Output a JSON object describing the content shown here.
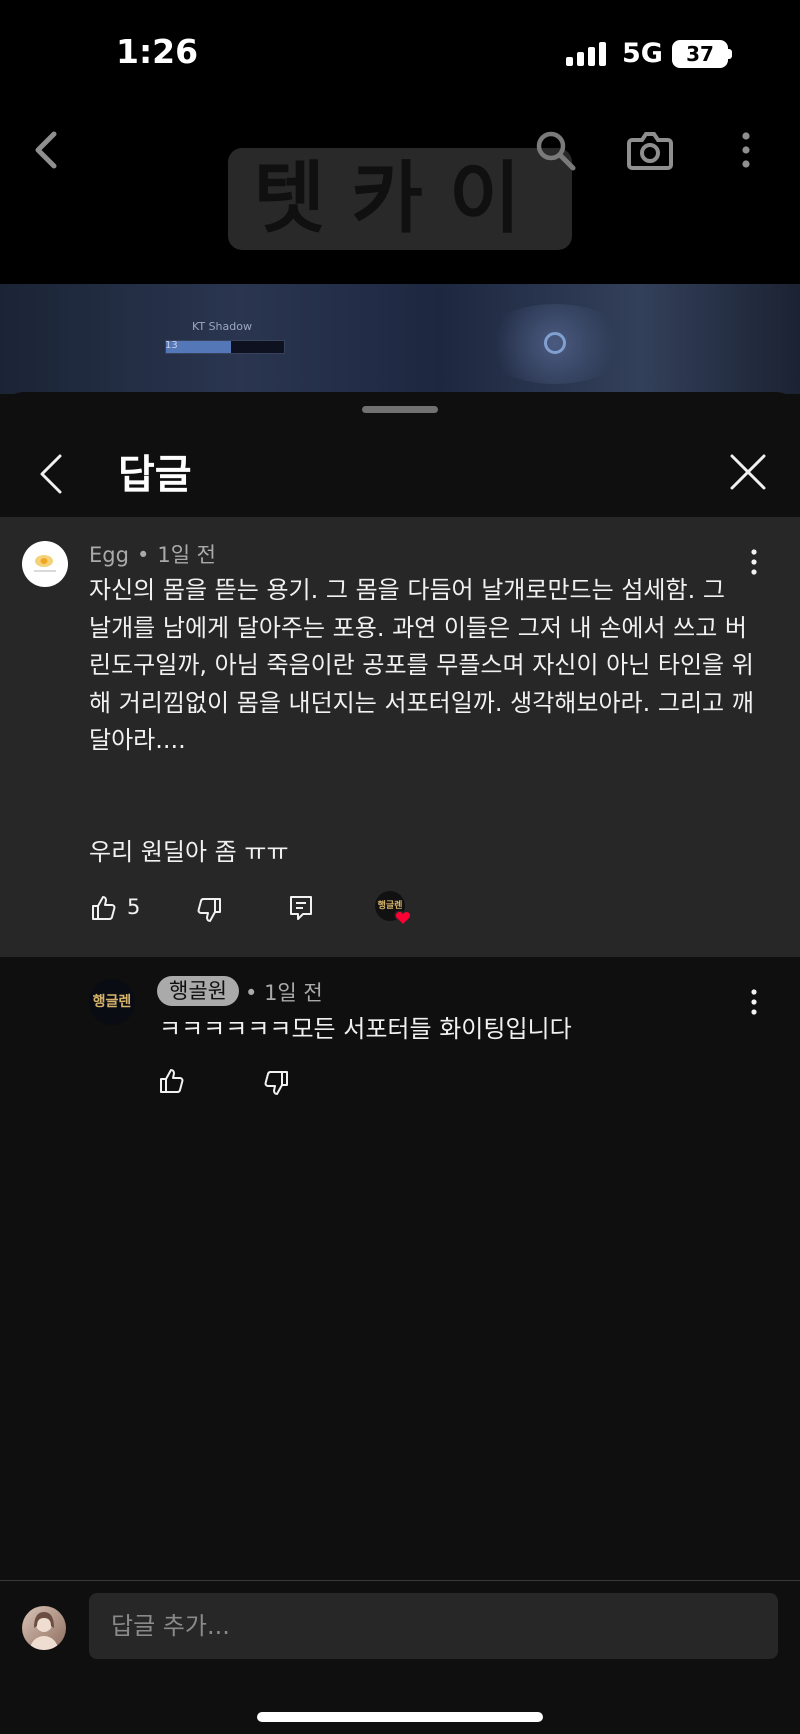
{
  "status_bar": {
    "time": "1:26",
    "network": "5G",
    "battery": "37"
  },
  "video": {
    "overlay_text": "텟카이",
    "hud_player_name": "KT Shadow",
    "hud_level": "13"
  },
  "sheet": {
    "title": "답글"
  },
  "parent_comment": {
    "author": "Egg",
    "time": "1일 전",
    "body": "자신의 몸을 뜯는 용기. 그 몸을 다듬어 날개로만드는 섬세함. 그 날개를 남에게 달아주는 포용. 과연 이들은 그저 내 손에서 쓰고 버린도구일까, 아님 죽음이란 공포를 무플스며 자신이 아닌 타인을 위해 거리낌없이 몸을 내던지는 서포터일까. 생각해보아라. 그리고 깨달아라....",
    "footer": "우리 원딜아 좀 ㅠㅠ",
    "like_count": "5",
    "creator_avatar_label": "행글렌"
  },
  "reply": {
    "author": "행골원",
    "time": "1일 전",
    "body": "ㅋㅋㅋㅋㅋㅋ모든 서포터들 화이팅입니다",
    "avatar_label": "행글렌"
  },
  "composer": {
    "placeholder": "답글 추가..."
  },
  "colors": {
    "background": "#0f0f0f",
    "highlighted_comment": "#272727",
    "secondary_text": "#aaaaaa",
    "heart": "#ff0033"
  }
}
